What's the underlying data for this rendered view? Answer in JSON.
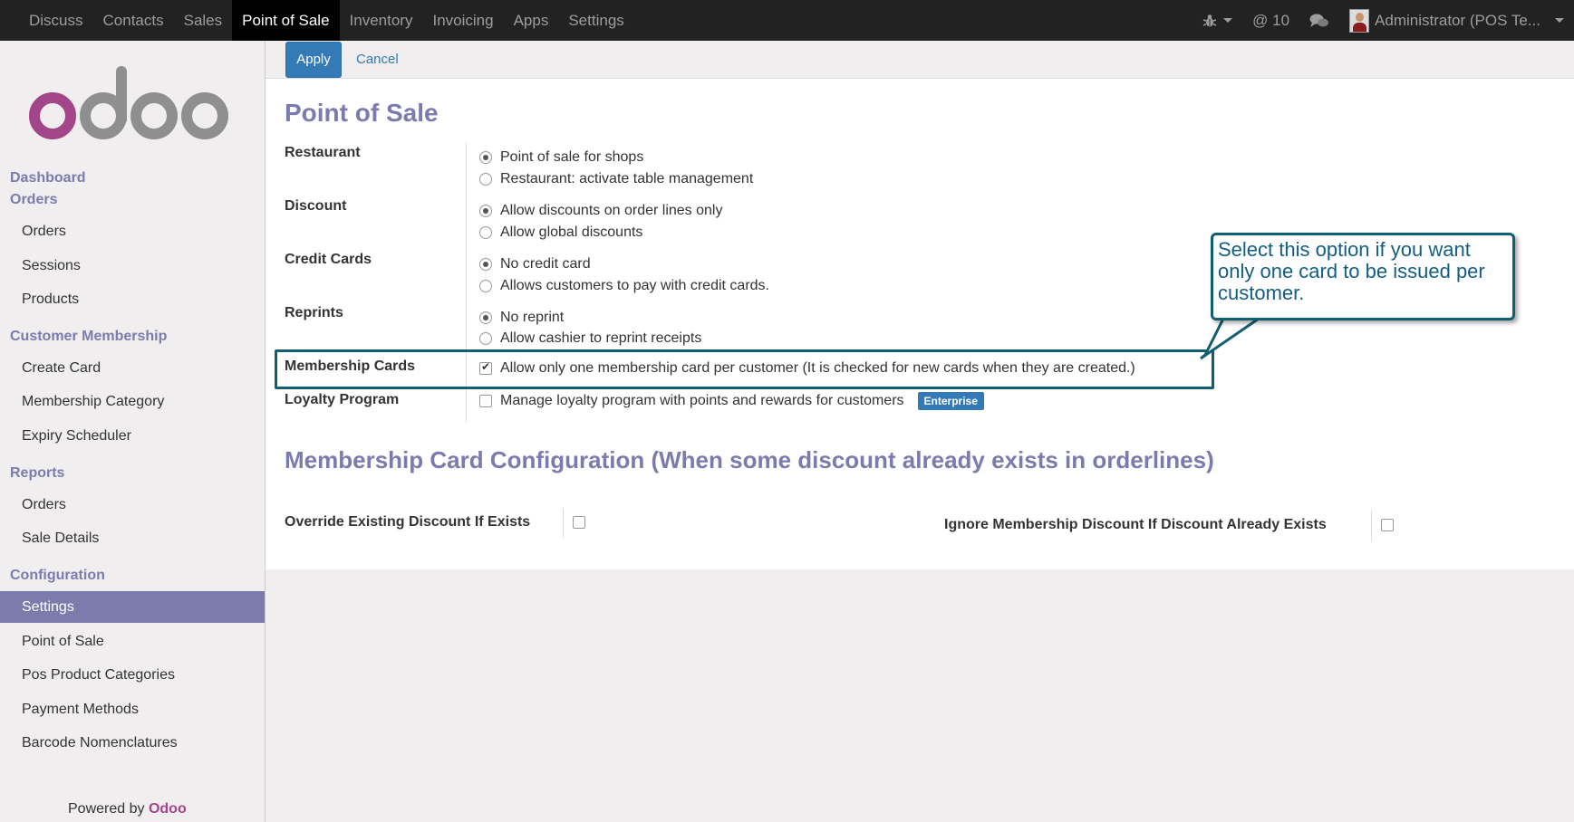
{
  "topbar": {
    "menu": [
      "Discuss",
      "Contacts",
      "Sales",
      "Point of Sale",
      "Inventory",
      "Invoicing",
      "Apps",
      "Settings"
    ],
    "active_menu": "Point of Sale",
    "messages_count": "@ 10",
    "user": "Administrator (POS Te..."
  },
  "sidebar": {
    "logo_text": "odoo",
    "sections": {
      "dashboard": "Dashboard",
      "orders": "Orders",
      "customer_membership": "Customer Membership",
      "reports": "Reports",
      "configuration": "Configuration"
    },
    "orders_items": [
      "Orders",
      "Sessions",
      "Products"
    ],
    "membership_items": [
      "Create Card",
      "Membership Category",
      "Expiry Scheduler"
    ],
    "reports_items": [
      "Orders",
      "Sale Details"
    ],
    "configuration_items": [
      "Settings",
      "Point of Sale",
      "Pos Product Categories",
      "Payment Methods",
      "Barcode Nomenclatures"
    ],
    "active_item": "Settings",
    "powered_prefix": "Powered by",
    "powered_brand": "Odoo"
  },
  "controls": {
    "apply": "Apply",
    "cancel": "Cancel"
  },
  "form": {
    "title": "Point of Sale",
    "fields": {
      "restaurant": {
        "label": "Restaurant",
        "options": [
          "Point of sale for shops",
          "Restaurant: activate table management"
        ],
        "selected": 0
      },
      "discount": {
        "label": "Discount",
        "options": [
          "Allow discounts on order lines only",
          "Allow global discounts"
        ],
        "selected": 0
      },
      "credit_cards": {
        "label": "Credit Cards",
        "options": [
          "No credit card",
          "Allows customers to pay with credit cards."
        ],
        "selected": 0
      },
      "reprints": {
        "label": "Reprints",
        "options": [
          "No reprint",
          "Allow cashier to reprint receipts"
        ],
        "selected": 0
      },
      "membership_cards": {
        "label": "Membership Cards",
        "option": "Allow only one membership card per customer (It is checked for new cards when they are created.)",
        "checked": true
      },
      "loyalty_program": {
        "label": "Loyalty Program",
        "option": "Manage loyalty program with points and rewards for customers",
        "checked": false,
        "badge": "Enterprise"
      }
    },
    "config_title": "Membership Card Configuration (When some discount already exists in orderlines)",
    "override_label": "Override Existing Discount If Exists",
    "override_checked": false,
    "ignore_label": "Ignore Membership Discount If Discount Already Exists",
    "ignore_checked": false
  },
  "callout": {
    "line1": "Select this option if you want",
    "line2": "only one card to be issued per",
    "line3": "customer."
  },
  "colors": {
    "accent": "#7c7bad",
    "button": "#337ab7",
    "callout_border": "#125f73",
    "odoo_purple": "#a24689"
  }
}
